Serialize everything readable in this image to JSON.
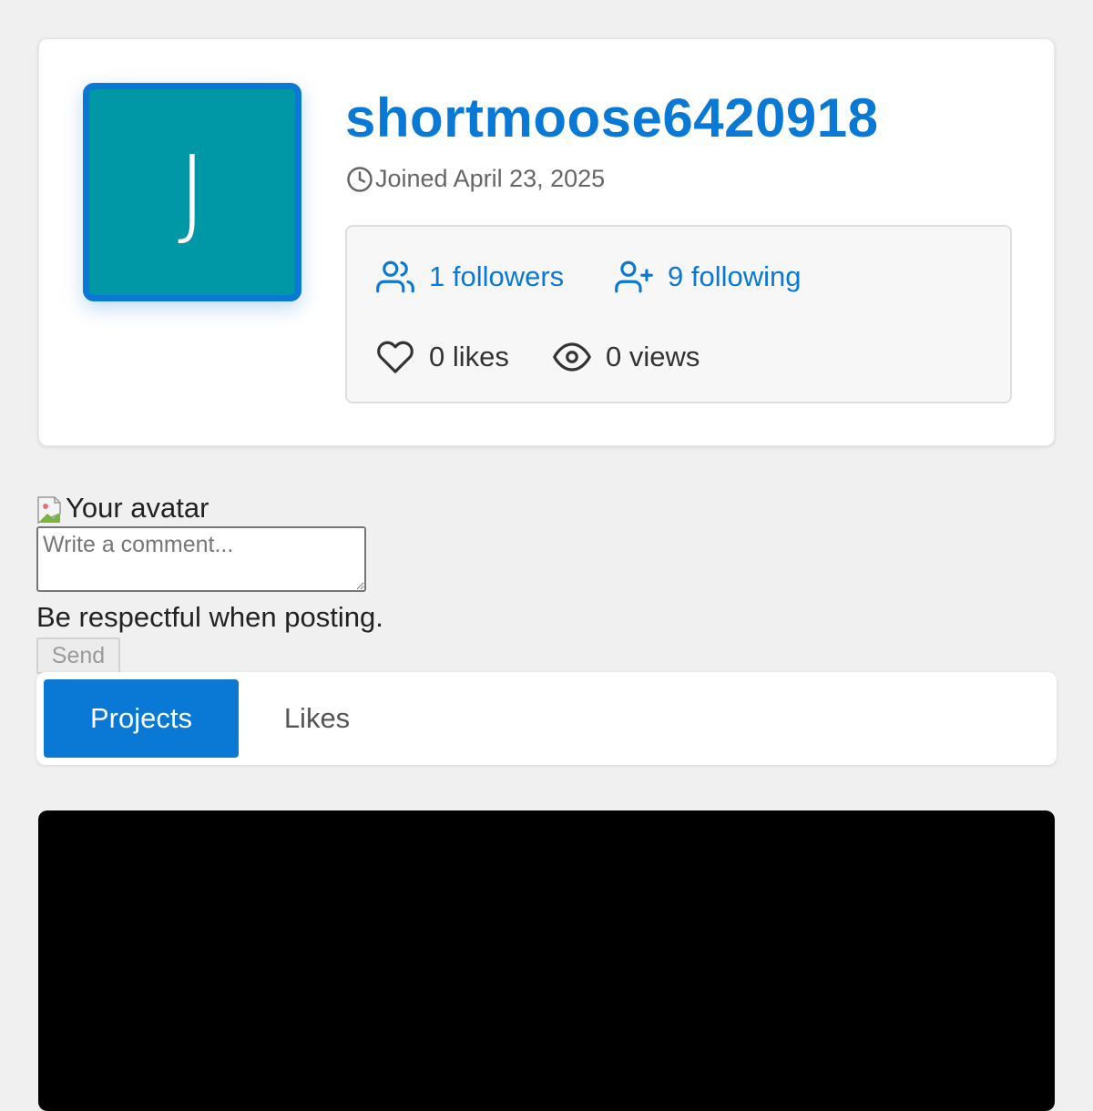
{
  "profile": {
    "avatar_letter": "J",
    "username": "shortmoose6420918",
    "joined": "Joined April 23, 2025",
    "stats": {
      "followers": "1 followers",
      "following": "9 following",
      "likes": "0 likes",
      "views": "0 views"
    }
  },
  "comment": {
    "avatar_alt": "Your avatar",
    "placeholder": "Write a comment...",
    "hint": "Be respectful when posting.",
    "send_label": "Send"
  },
  "tabs": [
    {
      "label": "Projects",
      "active": true
    },
    {
      "label": "Likes",
      "active": false
    }
  ],
  "colors": {
    "accent": "#0a78d5",
    "avatar_bg": "#0097a7",
    "page_bg": "#f0f0f0"
  },
  "icons": [
    "clock-icon",
    "users-icon",
    "user-plus-icon",
    "heart-icon",
    "eye-icon"
  ]
}
